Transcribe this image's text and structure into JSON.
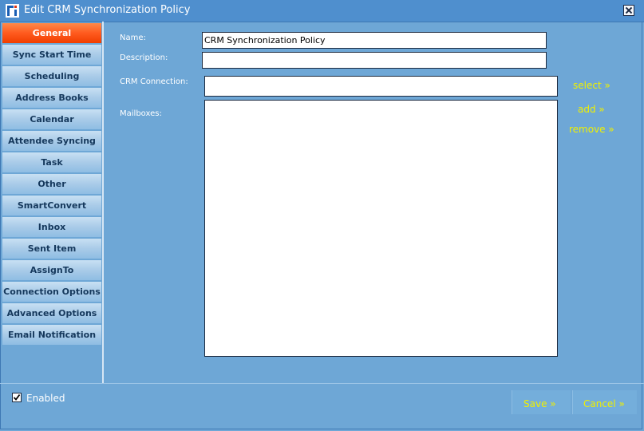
{
  "window": {
    "title": "Edit CRM Synchronization Policy",
    "close_icon": "close-x-icon",
    "app_icon": "app-logo-icon"
  },
  "sidebar": {
    "items": [
      {
        "label": "General",
        "active": true
      },
      {
        "label": "Sync Start Time",
        "active": false
      },
      {
        "label": "Scheduling",
        "active": false
      },
      {
        "label": "Address Books",
        "active": false
      },
      {
        "label": "Calendar",
        "active": false
      },
      {
        "label": "Attendee Syncing",
        "active": false
      },
      {
        "label": "Task",
        "active": false
      },
      {
        "label": "Other",
        "active": false
      },
      {
        "label": "SmartConvert",
        "active": false
      },
      {
        "label": "Inbox",
        "active": false
      },
      {
        "label": "Sent Item",
        "active": false
      },
      {
        "label": "AssignTo",
        "active": false
      },
      {
        "label": "Connection Options",
        "active": false
      },
      {
        "label": "Advanced Options",
        "active": false
      },
      {
        "label": "Email Notification",
        "active": false
      }
    ]
  },
  "form": {
    "name_label": "Name:",
    "name_value": "CRM Synchronization Policy",
    "description_label": "Description:",
    "description_value": "",
    "crm_connection_label": "CRM Connection:",
    "crm_connection_value": "",
    "mailboxes_label": "Mailboxes:",
    "mailboxes_items": []
  },
  "links": {
    "select": "select »",
    "add": "add »",
    "remove": "remove »"
  },
  "footer": {
    "enabled_label": "Enabled",
    "enabled_checked": true,
    "save_label": "Save »",
    "cancel_label": "Cancel »"
  },
  "colors": {
    "background": "#6ea7d6",
    "titlebar": "#4f8fce",
    "active_tab": "#ff5a1e",
    "link": "#f0f000"
  }
}
